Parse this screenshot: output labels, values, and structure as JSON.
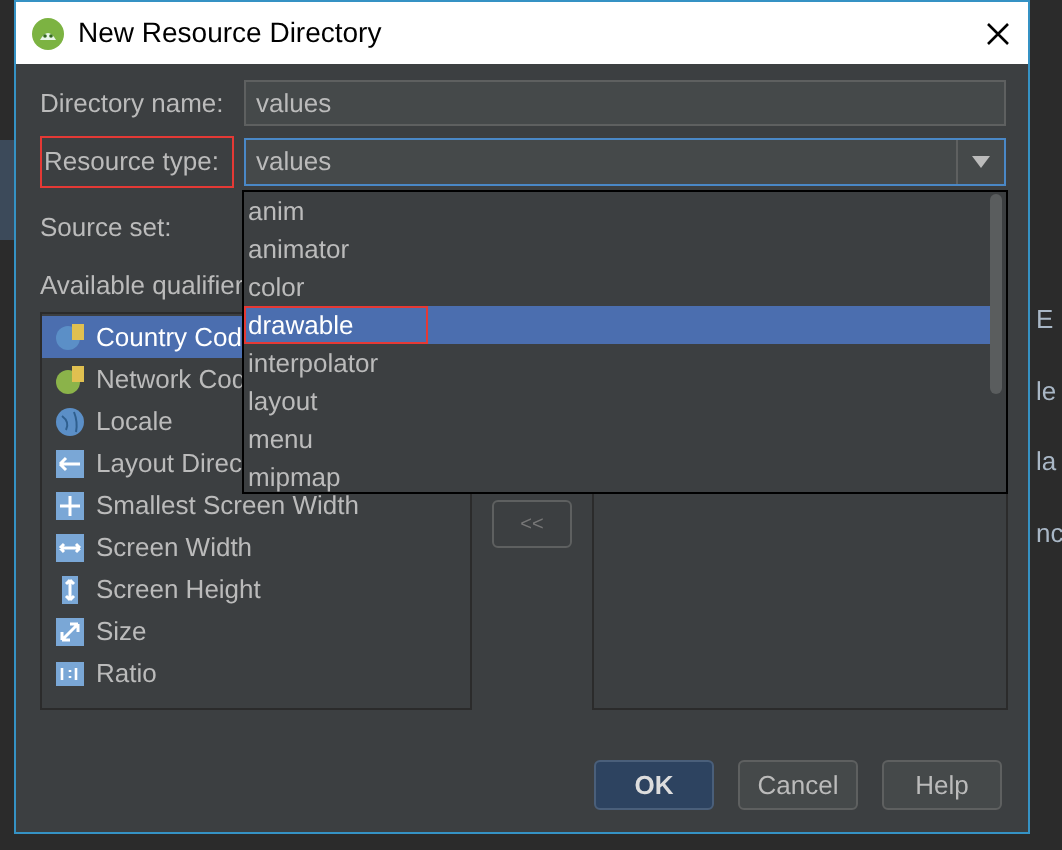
{
  "window": {
    "title": "New Resource Directory"
  },
  "directory_name": {
    "label": "Directory name:",
    "value": "values"
  },
  "resource_type": {
    "label": "Resource type:",
    "value": "values",
    "highlighted": true
  },
  "resource_type_dropdown": {
    "items": [
      {
        "label": "anim",
        "selected": false,
        "highlighted": false
      },
      {
        "label": "animator",
        "selected": false,
        "highlighted": false
      },
      {
        "label": "color",
        "selected": false,
        "highlighted": false
      },
      {
        "label": "drawable",
        "selected": true,
        "highlighted": true
      },
      {
        "label": "interpolator",
        "selected": false,
        "highlighted": false
      },
      {
        "label": "layout",
        "selected": false,
        "highlighted": false
      },
      {
        "label": "menu",
        "selected": false,
        "highlighted": false
      },
      {
        "label": "mipmap",
        "selected": false,
        "highlighted": false
      }
    ]
  },
  "source_set": {
    "label": "Source set:"
  },
  "available_qualifiers": {
    "label": "Available qualifier",
    "items": [
      {
        "label": "Country Cod",
        "selected": true
      },
      {
        "label": "Network Cod",
        "selected": false
      },
      {
        "label": "Locale",
        "selected": false
      },
      {
        "label": "Layout Direc",
        "selected": false
      },
      {
        "label": "Smallest Screen Width",
        "selected": false
      },
      {
        "label": "Screen Width",
        "selected": false
      },
      {
        "label": "Screen Height",
        "selected": false
      },
      {
        "label": "Size",
        "selected": false
      },
      {
        "label": "Ratio",
        "selected": false
      }
    ]
  },
  "remove_button": {
    "label": "<<"
  },
  "buttons": [
    {
      "label": "OK",
      "kind": "default"
    },
    {
      "label": "Cancel",
      "kind": "normal"
    },
    {
      "label": "Help",
      "kind": "normal"
    }
  ],
  "background_editor": [
    "E",
    "le",
    "la",
    "nc"
  ]
}
